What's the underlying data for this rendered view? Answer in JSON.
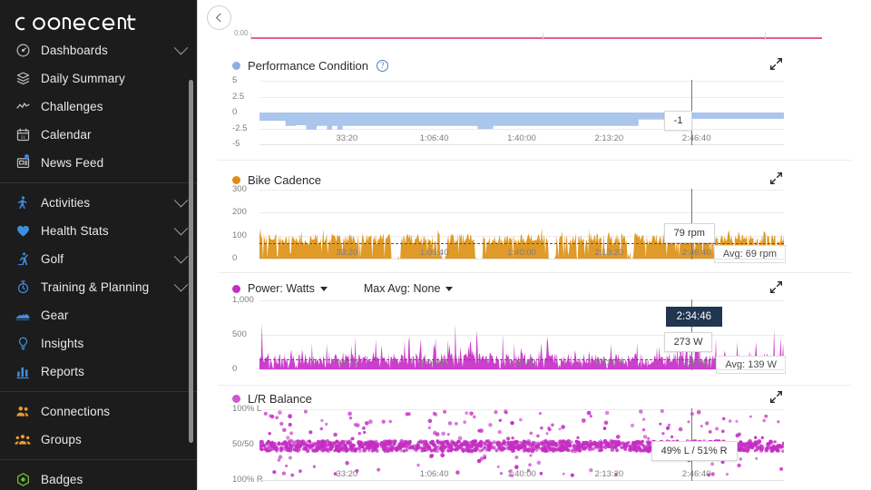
{
  "app": {
    "brand": "connect",
    "brand_color": "#ffffff",
    "sidebar_bg": "#1c1c1c"
  },
  "sidebar": {
    "groups": [
      {
        "items": [
          {
            "label": "Dashboards",
            "icon": "gauge-icon",
            "color": "#bdbdbd",
            "expandable": true,
            "badge": false
          },
          {
            "label": "Daily Summary",
            "icon": "layers-icon",
            "color": "#bdbdbd",
            "expandable": false,
            "badge": false
          },
          {
            "label": "Challenges",
            "icon": "wave-icon",
            "color": "#bdbdbd",
            "expandable": false,
            "badge": false
          },
          {
            "label": "Calendar",
            "icon": "calendar-icon",
            "color": "#bdbdbd",
            "expandable": false,
            "badge": false
          },
          {
            "label": "News Feed",
            "icon": "news-icon",
            "color": "#bdbdbd",
            "expandable": false,
            "badge": true
          }
        ]
      },
      {
        "items": [
          {
            "label": "Activities",
            "icon": "runner-icon",
            "color": "#3e8ede",
            "expandable": true,
            "badge": false
          },
          {
            "label": "Health Stats",
            "icon": "heart-icon",
            "color": "#3e8ede",
            "expandable": true,
            "badge": false
          },
          {
            "label": "Golf",
            "icon": "golfer-icon",
            "color": "#3e8ede",
            "expandable": true,
            "badge": false
          },
          {
            "label": "Training & Planning",
            "icon": "stopwatch-icon",
            "color": "#3e8ede",
            "expandable": true,
            "badge": false
          },
          {
            "label": "Gear",
            "icon": "shoe-icon",
            "color": "#3e8ede",
            "expandable": false,
            "badge": false
          },
          {
            "label": "Insights",
            "icon": "bulb-icon",
            "color": "#3e8ede",
            "expandable": false,
            "badge": false
          },
          {
            "label": "Reports",
            "icon": "barchart-icon",
            "color": "#3e8ede",
            "expandable": false,
            "badge": false
          }
        ]
      },
      {
        "items": [
          {
            "label": "Connections",
            "icon": "two-people-icon",
            "color": "#eb9b2d",
            "expandable": false,
            "badge": false
          },
          {
            "label": "Groups",
            "icon": "three-people-icon",
            "color": "#eb9b2d",
            "expandable": false,
            "badge": false
          }
        ]
      },
      {
        "items": [
          {
            "label": "Badges",
            "icon": "badge-hex-icon",
            "color": "#6fbf3a",
            "expandable": false,
            "badge": false
          }
        ]
      }
    ]
  },
  "toolbar": {
    "back_label": "Back",
    "back_icon": "chevron-left-icon"
  },
  "charts": [
    {
      "id": "performance-condition",
      "title": "Performance Condition",
      "color": "#8bafe3",
      "fill": "#a7c3ec",
      "has_help": true,
      "expand_icon": "expand-diagonal-icon",
      "y_ticks": [
        "5",
        "2.5",
        "0",
        "-2.5",
        "-5"
      ],
      "x_ticks": [
        "33:20",
        "1:06:40",
        "1:40:00",
        "2:13:20",
        "2:46:40"
      ],
      "tooltip": {
        "value": "-1",
        "time": "2:46:40"
      }
    },
    {
      "id": "bike-cadence",
      "title": "Bike Cadence",
      "color": "#e08a15",
      "fill": "#e09a28",
      "has_help": false,
      "expand_icon": "expand-diagonal-icon",
      "y_ticks": [
        "300",
        "200",
        "100",
        "0"
      ],
      "x_ticks": [
        "33:20",
        "1:06:40",
        "1:40:00",
        "2:13:20",
        "2:46:40"
      ],
      "tooltip": {
        "value": "79 rpm",
        "time": "2:46:40"
      },
      "average_label": "Avg: 69 rpm"
    },
    {
      "id": "power-watts",
      "title": "Power: Watts",
      "color": "#c42ec4",
      "fill": "#cc3fcc",
      "has_help": false,
      "is_dropdown": true,
      "secondary_dropdown": "Max Avg: None",
      "expand_icon": "expand-diagonal-icon",
      "y_ticks": [
        "1,000",
        "500",
        "0"
      ],
      "x_ticks": [
        "33:20",
        "1:06:40",
        "1:40:00",
        "2:13:20",
        "2:46:40"
      ],
      "tooltip": {
        "value": "273 W",
        "time_badge": "2:34:46",
        "time": "2:46:40"
      },
      "average_label": "Avg: 139 W"
    },
    {
      "id": "lr-balance",
      "title": "L/R Balance",
      "color": "#d455d4",
      "fill": "#c42ec4",
      "has_help": false,
      "expand_icon": "expand-diagonal-icon",
      "y_ticks": [
        "100% L",
        "50/50",
        "100% R"
      ],
      "x_ticks": [
        "33:20",
        "1:06:40",
        "1:40:00",
        "2:13:20",
        "2:46:40"
      ],
      "tooltip": {
        "value": "49% L / 51% R",
        "time": "2:46:40"
      }
    }
  ],
  "chart_data": [
    {
      "type": "area",
      "id": "performance-condition",
      "title": "Performance Condition",
      "xlabel": "",
      "ylabel": "",
      "ylim": [
        -5,
        5
      ],
      "y_ticks": [
        5,
        2.5,
        0,
        -2.5,
        -5
      ],
      "x_tick_labels": [
        "33:20",
        "1:06:40",
        "1:40:00",
        "2:13:20",
        "2:46:40"
      ],
      "grid": true,
      "legend": "Performance Condition",
      "series_color": "#a7c3ec",
      "baseline": 0,
      "values": [
        -1.3,
        -1.3,
        -1.3,
        -1.3,
        -1.3,
        -2.1,
        -2.1,
        -2.0,
        -2.0,
        -2.7,
        -2.7,
        -2.1,
        -2.1,
        -2.7,
        -2.1,
        -2.7,
        -2.1,
        -2.1,
        -2.1,
        -2.1,
        -2.1,
        -2.1,
        -2.1,
        -2.1,
        -2.1,
        -2.1,
        -2.1,
        -2.1,
        -2.1,
        -2.1,
        -2.1,
        -2.1,
        -2.1,
        -2.1,
        -2.1,
        -2.1,
        -2.1,
        -2.1,
        -2.1,
        -2.1,
        -2.1,
        -2.1,
        -2.6,
        -2.6,
        -2.6,
        -2.1,
        -2.1,
        -2.1,
        -2.1,
        -2.1,
        -2.1,
        -2.1,
        -2.1,
        -2.1,
        -2.1,
        -2.1,
        -2.1,
        -2.1,
        -2.1,
        -2.1,
        -2.1,
        -2.1,
        -2.1,
        -2.1,
        -2.1,
        -2.1,
        -2.1,
        -2.1,
        -2.1,
        -2.1,
        -2.1,
        -2.1,
        -2.1,
        -1.1,
        -1.1,
        -1.1,
        -1.1,
        -1.1,
        -1.0,
        -1.0,
        -1.0,
        -1.0,
        -1.0,
        -1.0,
        -1.0,
        -1.0,
        -1.0,
        -1.0,
        -1.0,
        -1.0,
        -1.0,
        -1.0,
        -1.0,
        -1.0,
        -1.0,
        -1.0,
        -1.0,
        -1.0,
        -1.0,
        -1.0,
        -1.0,
        -1.0
      ],
      "annotation": {
        "label": "-1",
        "at_x": "2:46:40"
      }
    },
    {
      "type": "area",
      "id": "bike-cadence",
      "title": "Bike Cadence",
      "xlabel": "",
      "ylabel": "rpm",
      "ylim": [
        0,
        300
      ],
      "y_ticks": [
        300,
        200,
        100,
        0
      ],
      "x_tick_labels": [
        "33:20",
        "1:06:40",
        "1:40:00",
        "2:13:20",
        "2:46:40"
      ],
      "grid": true,
      "legend": "Bike Cadence",
      "series_color": "#e09a28",
      "average": 69,
      "average_label": "Avg: 69 rpm",
      "annotation": {
        "label": "79 rpm",
        "at_x": "2:46:40"
      },
      "note": "dense high-frequency cadence trace oscillating between 0 and ~110 rpm across the ride"
    },
    {
      "type": "area",
      "id": "power-watts",
      "title": "Power: Watts",
      "xlabel": "",
      "ylabel": "W",
      "ylim": [
        0,
        1000
      ],
      "y_ticks": [
        1000,
        500,
        0
      ],
      "x_tick_labels": [
        "33:20",
        "1:06:40",
        "1:40:00",
        "2:13:20",
        "2:46:40"
      ],
      "grid": true,
      "legend": "Power: Watts",
      "series_color": "#cc3fcc",
      "average": 139,
      "average_label": "Avg: 139 W",
      "annotation": {
        "label": "273 W",
        "time": "2:34:46",
        "at_x": "2:46:40"
      },
      "note": "spiky power trace, typical peaks 150-500 W with occasional spikes near 700 W"
    },
    {
      "type": "scatter",
      "id": "lr-balance",
      "title": "L/R Balance",
      "xlabel": "",
      "ylabel": "",
      "y_ticks": [
        "100% L",
        "50/50",
        "100% R"
      ],
      "x_tick_labels": [
        "33:20",
        "1:06:40",
        "1:40:00",
        "2:13:20",
        "2:46:40"
      ],
      "grid": true,
      "legend": "L/R Balance",
      "series_color": "#c42ec4",
      "annotation": {
        "label": "49% L / 51% R",
        "at_x": "2:46:40"
      },
      "note": "dense cloud of points centered slightly below 50/50 with scattered outliers at 100% L and 100% R"
    }
  ]
}
